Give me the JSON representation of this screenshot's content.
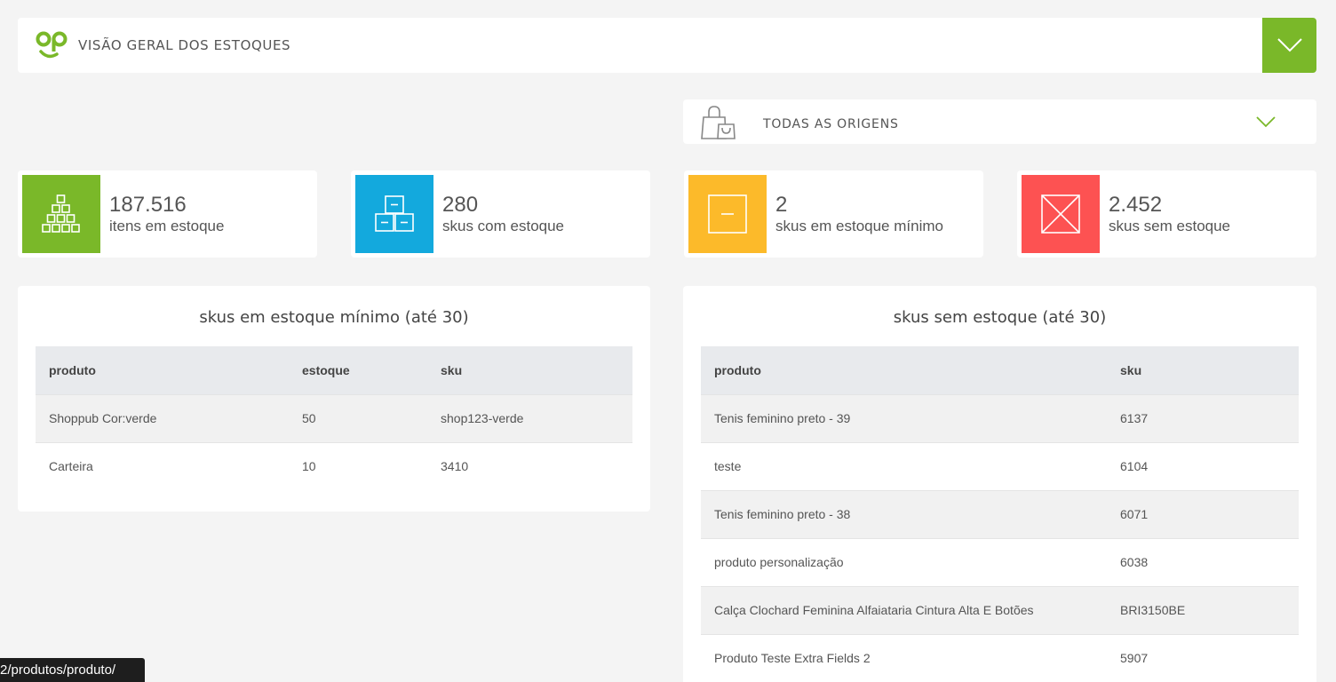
{
  "header": {
    "title": "VISÃO GERAL DOS ESTOQUES"
  },
  "origin_filter": {
    "selected": "TODAS AS ORIGENS"
  },
  "stats": [
    {
      "value": "187.516",
      "label": "itens em estoque",
      "color": "#7ab829",
      "icon": "stacked-boxes-icon"
    },
    {
      "value": "280",
      "label": "skus com estoque",
      "color": "#13a9dd",
      "icon": "boxes-icon"
    },
    {
      "value": "2",
      "label": "skus em estoque mínimo",
      "color": "#fcba2a",
      "icon": "minus-box-icon"
    },
    {
      "value": "2.452",
      "label": "skus sem estoque",
      "color": "#fd5252",
      "icon": "x-box-icon"
    }
  ],
  "min_stock": {
    "title": "skus em estoque mínimo (até 30)",
    "columns": [
      "produto",
      "estoque",
      "sku"
    ],
    "rows": [
      [
        "Shoppub Cor:verde",
        "50",
        "shop123-verde"
      ],
      [
        "Carteira",
        "10",
        "3410"
      ]
    ]
  },
  "no_stock": {
    "title": "skus sem estoque (até 30)",
    "columns": [
      "produto",
      "sku"
    ],
    "rows": [
      [
        "Tenis feminino preto - 39",
        "6137"
      ],
      [
        "teste",
        "6104"
      ],
      [
        "Tenis feminino preto - 38",
        "6071"
      ],
      [
        "produto personalização",
        "6038"
      ],
      [
        "Calça Clochard Feminina Alfaiataria Cintura Alta E Botões",
        "BRI3150BE"
      ],
      [
        "Produto Teste Extra Fields 2",
        "5907"
      ]
    ]
  },
  "status_bar": {
    "url": "2/produtos/produto/"
  },
  "colors": {
    "brand": "#7ab829"
  }
}
